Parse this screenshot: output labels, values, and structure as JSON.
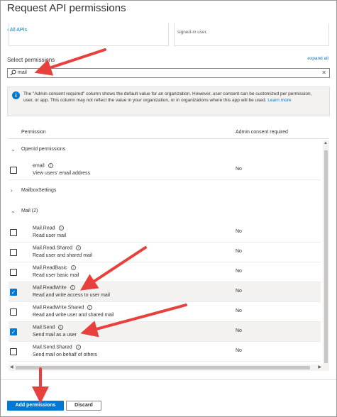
{
  "panel": {
    "title": "Request API permissions",
    "back_link": "All APIs",
    "back_chevron": "‹",
    "right_card_text": "signed-in user."
  },
  "permissions": {
    "label": "Select permissions",
    "expand_all": "expand all",
    "search_value": "mail",
    "search_icon": "search-icon",
    "clear_icon": "close-icon"
  },
  "notice": {
    "text": "The \"Admin consent required\" column shows the default value for an organization. However, user consent can be customized per permission, user, or app. This column may not reflect the value in your organization, or in organizations where this app will be used.",
    "link": "Learn more"
  },
  "table": {
    "col_permission": "Permission",
    "col_admin": "Admin consent required",
    "groups": [
      {
        "label": "OpenId permissions",
        "expanded": true,
        "rows": [
          {
            "name": "email",
            "desc": "View users' email address",
            "admin": "No",
            "checked": false
          }
        ]
      },
      {
        "label": "MailboxSettings",
        "expanded": false,
        "rows": []
      },
      {
        "label": "Mail (2)",
        "expanded": true,
        "rows": [
          {
            "name": "Mail.Read",
            "desc": "Read user mail",
            "admin": "No",
            "checked": false
          },
          {
            "name": "Mail.Read.Shared",
            "desc": "Read user and shared mail",
            "admin": "No",
            "checked": false
          },
          {
            "name": "Mail.ReadBasic",
            "desc": "Read user basic mail",
            "admin": "No",
            "checked": false
          },
          {
            "name": "Mail.ReadWrite",
            "desc": "Read and write access to user mail",
            "admin": "No",
            "checked": true
          },
          {
            "name": "Mail.ReadWrite.Shared",
            "desc": "Read and write user and shared mail",
            "admin": "No",
            "checked": false
          },
          {
            "name": "Mail.Send",
            "desc": "Send mail as a user",
            "admin": "No",
            "checked": true
          },
          {
            "name": "Mail.Send.Shared",
            "desc": "Send mail on behalf of others",
            "admin": "No",
            "checked": false
          }
        ]
      }
    ]
  },
  "footer": {
    "add_label": "Add permissions",
    "discard_label": "Discard"
  },
  "colors": {
    "accent": "#0078d4",
    "annotation_arrow": "#e8403d"
  }
}
